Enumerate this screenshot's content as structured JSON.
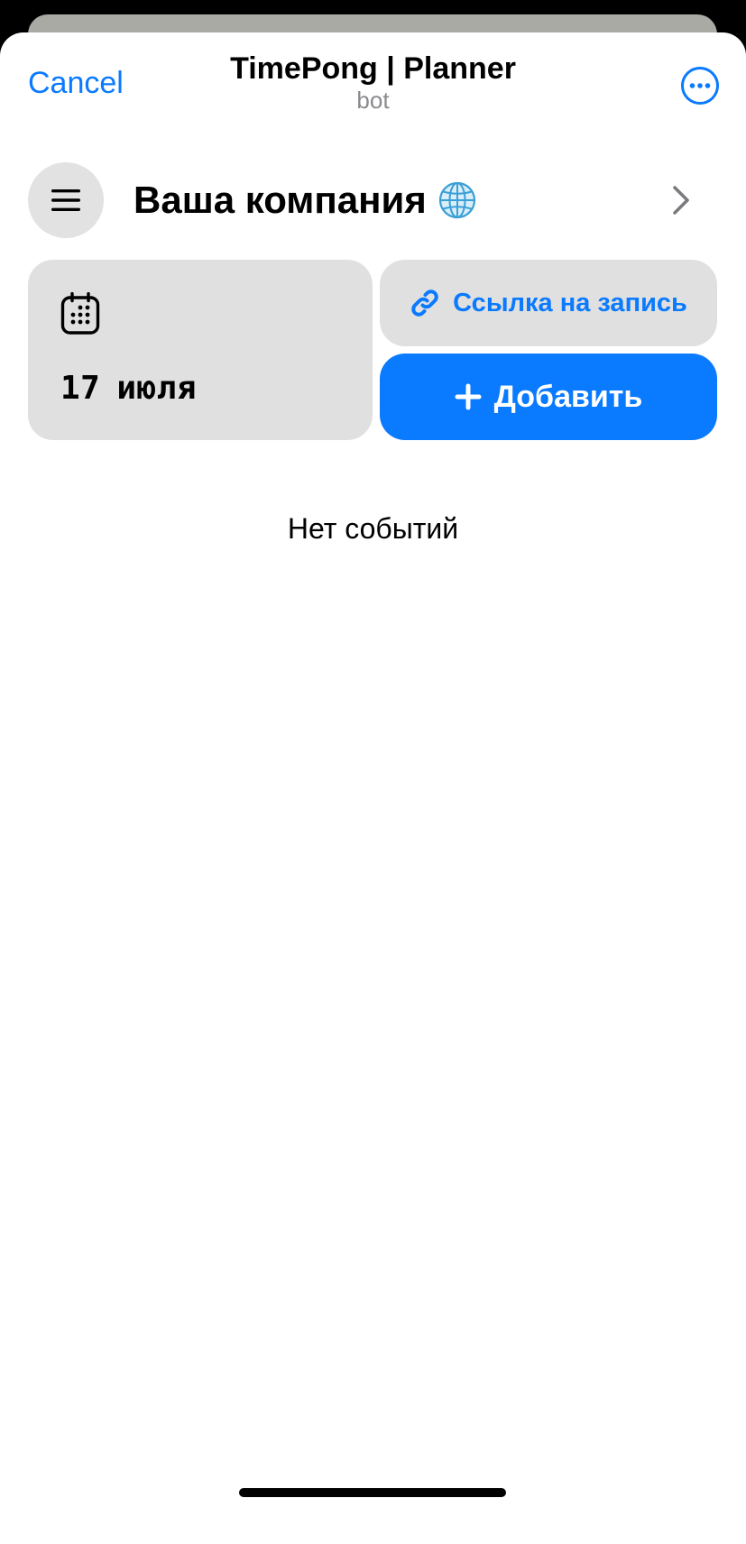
{
  "header": {
    "cancel_label": "Cancel",
    "title": "TimePong | Planner",
    "subtitle": "bot"
  },
  "company": {
    "name": "Ваша компания"
  },
  "date_card": {
    "day": "17",
    "month": "июля"
  },
  "actions": {
    "link_label": "Ссылка на запись",
    "add_label": "Добавить"
  },
  "events": {
    "empty_text": "Нет событий"
  },
  "colors": {
    "accent": "#0a7aff",
    "card_bg": "#e0e0e0"
  },
  "icons": {
    "more": "more-horizontal-icon",
    "menu": "hamburger-menu-icon",
    "globe": "globe-icon",
    "chevron": "chevron-right-icon",
    "calendar": "calendar-icon",
    "link": "link-icon",
    "plus": "plus-icon"
  }
}
